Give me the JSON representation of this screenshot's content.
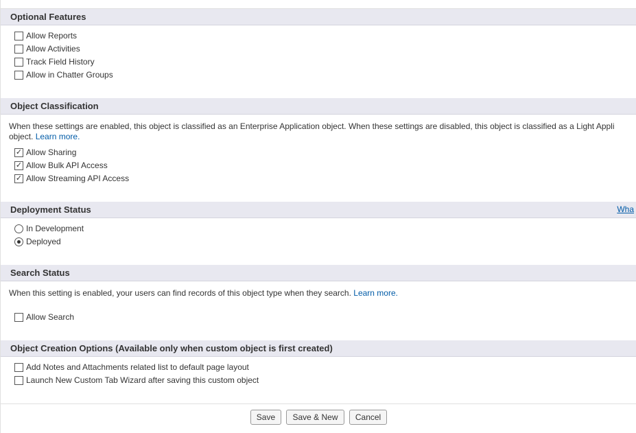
{
  "sections": {
    "optional_features": {
      "title": "Optional Features",
      "items": [
        {
          "label": "Allow Reports",
          "checked": false
        },
        {
          "label": "Allow Activities",
          "checked": false
        },
        {
          "label": "Track Field History",
          "checked": false
        },
        {
          "label": "Allow in Chatter Groups",
          "checked": false
        }
      ]
    },
    "object_classification": {
      "title": "Object Classification",
      "desc_prefix": "When these settings are enabled, this object is classified as an Enterprise Application object. When these settings are disabled, this object is classified as a Light Appli",
      "desc_line2": "object. ",
      "learn_more": "Learn more.",
      "items": [
        {
          "label": "Allow Sharing",
          "checked": true
        },
        {
          "label": "Allow Bulk API Access",
          "checked": true
        },
        {
          "label": "Allow Streaming API Access",
          "checked": true
        }
      ]
    },
    "deployment_status": {
      "title": "Deployment Status",
      "header_link": "Wha",
      "radios": [
        {
          "label": "In Development",
          "selected": false
        },
        {
          "label": "Deployed",
          "selected": true
        }
      ]
    },
    "search_status": {
      "title": "Search Status",
      "desc": "When this setting is enabled, your users can find records of this object type when they search. ",
      "learn_more": "Learn more.",
      "items": [
        {
          "label": "Allow Search",
          "checked": false
        }
      ]
    },
    "object_creation_options": {
      "title": "Object Creation Options (Available only when custom object is first created)",
      "items": [
        {
          "label": "Add Notes and Attachments related list to default page layout",
          "checked": false
        },
        {
          "label": "Launch New Custom Tab Wizard after saving this custom object",
          "checked": false
        }
      ]
    }
  },
  "buttons": {
    "save": "Save",
    "save_new": "Save & New",
    "cancel": "Cancel"
  }
}
